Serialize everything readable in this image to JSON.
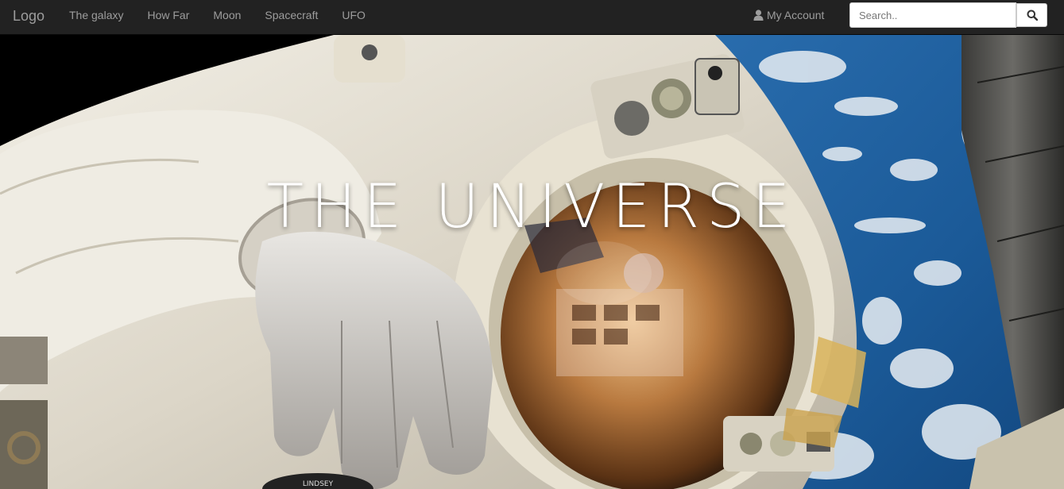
{
  "navbar": {
    "brand": "Logo",
    "links": [
      "The galaxy",
      "How Far",
      "Moon",
      "Spacecraft",
      "UFO"
    ],
    "account_label": "My Account",
    "search_placeholder": "Search..",
    "search_button_icon": "search-icon",
    "account_icon": "user-icon"
  },
  "hero": {
    "title": "THE UNIVERSE",
    "image_description_icon": "astronaut-photo",
    "patch_text": "LINDSEY"
  },
  "colors": {
    "navbar_bg": "#222222",
    "nav_text": "#9d9d9d",
    "earth_blue": "#1e5fa0",
    "space_black": "#000000"
  }
}
